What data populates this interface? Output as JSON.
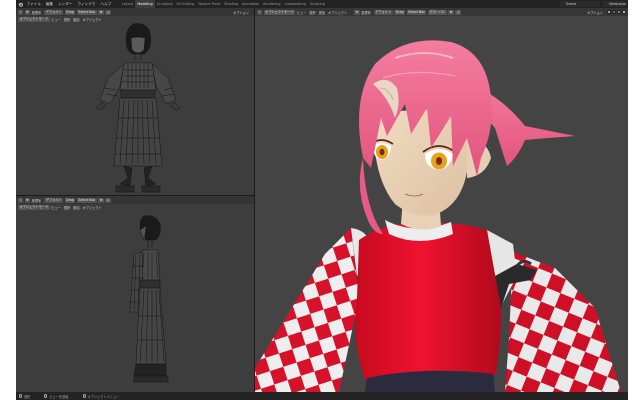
{
  "menu": {
    "items": [
      "ファイル",
      "編集",
      "レンダー",
      "ウィンドウ",
      "ヘルプ"
    ]
  },
  "workspaces": [
    "Layout",
    "Modeling",
    "Sculpting",
    "UV Editing",
    "Texture Paint",
    "Shading",
    "Animation",
    "Rendering",
    "Compositing",
    "Scripting"
  ],
  "active_workspace": "Modeling",
  "scene": {
    "scene_name": "Scene",
    "view_layer": "ViewLayer"
  },
  "viewport_header": {
    "mode": "オブジェクトモード",
    "view": "ビュー",
    "select": "選択",
    "add": "追加",
    "object": "オブジェクト",
    "orientation": "グローバル",
    "transform": "座標系",
    "pivot": "デフォルト",
    "drag": "Drag",
    "select_box": "Select Box",
    "options": "オプション"
  },
  "statusbar": {
    "select": "選択",
    "pan": "ビューを回転",
    "menu": "オブジェクトメニュー"
  },
  "colors": {
    "bg": "#1d1d1d",
    "viewport": "#3d3d3d",
    "accent": "#4772b3",
    "hair": "#f26b93",
    "top_red": "#e8102a"
  }
}
